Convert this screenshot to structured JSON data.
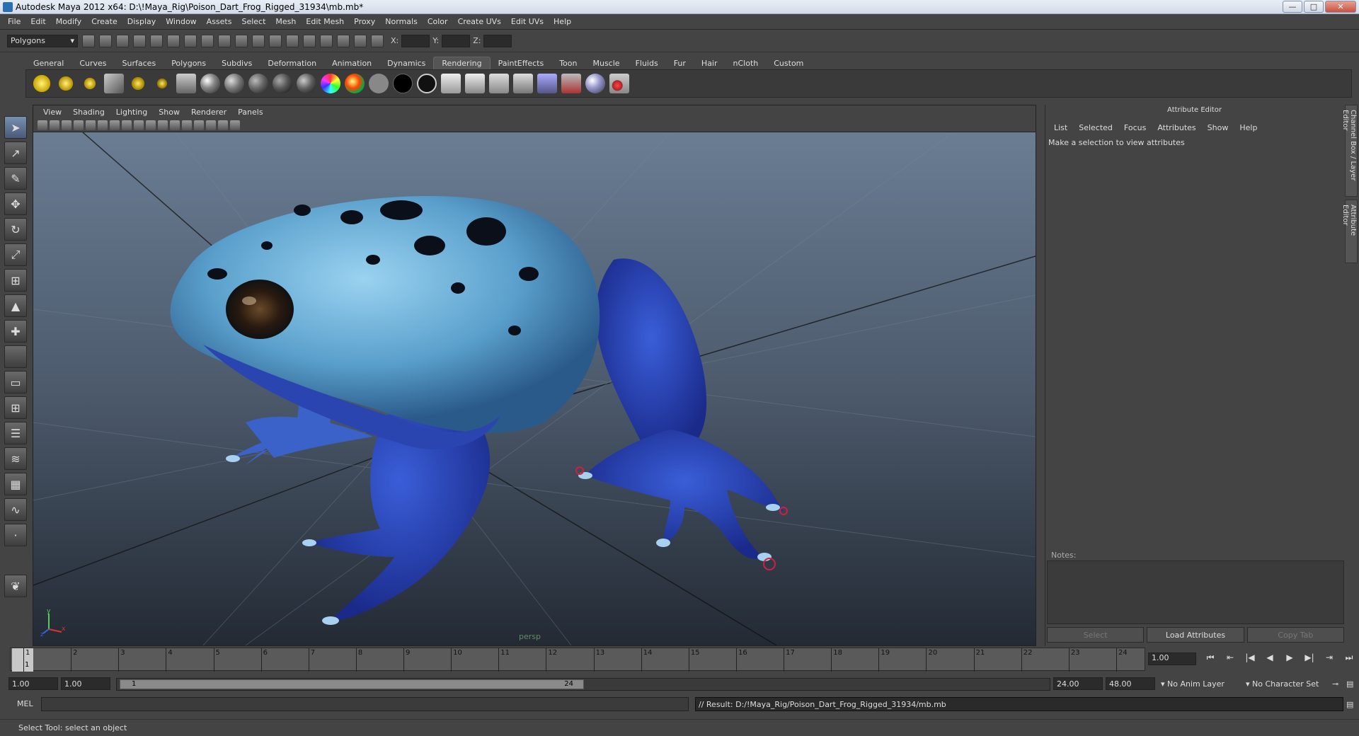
{
  "window": {
    "title": "Autodesk Maya 2012 x64: D:\\!Maya_Rig\\Poison_Dart_Frog_Rigged_31934\\mb.mb*",
    "minimize": "—",
    "maximize": "□",
    "close": "✕"
  },
  "menu": [
    "File",
    "Edit",
    "Modify",
    "Create",
    "Display",
    "Window",
    "Assets",
    "Select",
    "Mesh",
    "Edit Mesh",
    "Proxy",
    "Normals",
    "Color",
    "Create UVs",
    "Edit UVs",
    "Help"
  ],
  "status_line": {
    "mode": "Polygons",
    "x_label": "X:",
    "y_label": "Y:",
    "z_label": "Z:"
  },
  "shelf_tabs": [
    "General",
    "Curves",
    "Surfaces",
    "Polygons",
    "Subdivs",
    "Deformation",
    "Animation",
    "Dynamics",
    "Rendering",
    "PaintEffects",
    "Toon",
    "Muscle",
    "Fluids",
    "Fur",
    "Hair",
    "nCloth",
    "Custom"
  ],
  "active_shelf_tab": "Rendering",
  "viewport": {
    "menu": [
      "View",
      "Shading",
      "Lighting",
      "Show",
      "Renderer",
      "Panels"
    ],
    "camera_label": "persp",
    "axis_y": "y",
    "axis_x": "x",
    "axis_z": "z"
  },
  "attribute_editor": {
    "title": "Attribute Editor",
    "menu": [
      "List",
      "Selected",
      "Focus",
      "Attributes",
      "Show",
      "Help"
    ],
    "message": "Make a selection to view attributes",
    "notes_label": "Notes:",
    "select_button": "Select",
    "load_button": "Load Attributes",
    "copy_button": "Copy Tab",
    "side_tab_channel": "Channel Box / Layer Editor",
    "side_tab_attr": "Attribute Editor"
  },
  "timeline": {
    "ticks": [
      "1",
      "2",
      "3",
      "4",
      "5",
      "6",
      "7",
      "8",
      "9",
      "10",
      "11",
      "12",
      "13",
      "14",
      "15",
      "16",
      "17",
      "18",
      "19",
      "20",
      "21",
      "22",
      "23",
      "24"
    ],
    "current_frame_marker": "1",
    "current_time": "1.00"
  },
  "range": {
    "start_time": "1.00",
    "playback_start": "1.00",
    "range_start_label": "1",
    "range_end_label": "24",
    "playback_end": "24.00",
    "end_time": "48.00",
    "anim_layer": "No Anim Layer",
    "character_set": "No Character Set"
  },
  "command_line": {
    "label": "MEL",
    "result": "// Result: D:/!Maya_Rig/Poison_Dart_Frog_Rigged_31934/mb.mb"
  },
  "help_line": "Select Tool: select an object"
}
